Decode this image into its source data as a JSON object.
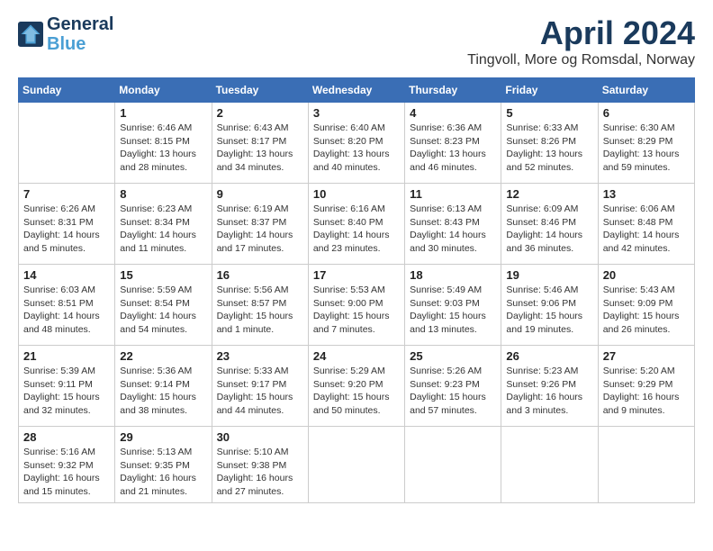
{
  "header": {
    "logo_line1": "General",
    "logo_line2": "Blue",
    "month": "April 2024",
    "location": "Tingvoll, More og Romsdal, Norway"
  },
  "calendar": {
    "headers": [
      "Sunday",
      "Monday",
      "Tuesday",
      "Wednesday",
      "Thursday",
      "Friday",
      "Saturday"
    ],
    "weeks": [
      [
        {
          "day": "",
          "info": ""
        },
        {
          "day": "1",
          "info": "Sunrise: 6:46 AM\nSunset: 8:15 PM\nDaylight: 13 hours\nand 28 minutes."
        },
        {
          "day": "2",
          "info": "Sunrise: 6:43 AM\nSunset: 8:17 PM\nDaylight: 13 hours\nand 34 minutes."
        },
        {
          "day": "3",
          "info": "Sunrise: 6:40 AM\nSunset: 8:20 PM\nDaylight: 13 hours\nand 40 minutes."
        },
        {
          "day": "4",
          "info": "Sunrise: 6:36 AM\nSunset: 8:23 PM\nDaylight: 13 hours\nand 46 minutes."
        },
        {
          "day": "5",
          "info": "Sunrise: 6:33 AM\nSunset: 8:26 PM\nDaylight: 13 hours\nand 52 minutes."
        },
        {
          "day": "6",
          "info": "Sunrise: 6:30 AM\nSunset: 8:29 PM\nDaylight: 13 hours\nand 59 minutes."
        }
      ],
      [
        {
          "day": "7",
          "info": "Sunrise: 6:26 AM\nSunset: 8:31 PM\nDaylight: 14 hours\nand 5 minutes."
        },
        {
          "day": "8",
          "info": "Sunrise: 6:23 AM\nSunset: 8:34 PM\nDaylight: 14 hours\nand 11 minutes."
        },
        {
          "day": "9",
          "info": "Sunrise: 6:19 AM\nSunset: 8:37 PM\nDaylight: 14 hours\nand 17 minutes."
        },
        {
          "day": "10",
          "info": "Sunrise: 6:16 AM\nSunset: 8:40 PM\nDaylight: 14 hours\nand 23 minutes."
        },
        {
          "day": "11",
          "info": "Sunrise: 6:13 AM\nSunset: 8:43 PM\nDaylight: 14 hours\nand 30 minutes."
        },
        {
          "day": "12",
          "info": "Sunrise: 6:09 AM\nSunset: 8:46 PM\nDaylight: 14 hours\nand 36 minutes."
        },
        {
          "day": "13",
          "info": "Sunrise: 6:06 AM\nSunset: 8:48 PM\nDaylight: 14 hours\nand 42 minutes."
        }
      ],
      [
        {
          "day": "14",
          "info": "Sunrise: 6:03 AM\nSunset: 8:51 PM\nDaylight: 14 hours\nand 48 minutes."
        },
        {
          "day": "15",
          "info": "Sunrise: 5:59 AM\nSunset: 8:54 PM\nDaylight: 14 hours\nand 54 minutes."
        },
        {
          "day": "16",
          "info": "Sunrise: 5:56 AM\nSunset: 8:57 PM\nDaylight: 15 hours\nand 1 minute."
        },
        {
          "day": "17",
          "info": "Sunrise: 5:53 AM\nSunset: 9:00 PM\nDaylight: 15 hours\nand 7 minutes."
        },
        {
          "day": "18",
          "info": "Sunrise: 5:49 AM\nSunset: 9:03 PM\nDaylight: 15 hours\nand 13 minutes."
        },
        {
          "day": "19",
          "info": "Sunrise: 5:46 AM\nSunset: 9:06 PM\nDaylight: 15 hours\nand 19 minutes."
        },
        {
          "day": "20",
          "info": "Sunrise: 5:43 AM\nSunset: 9:09 PM\nDaylight: 15 hours\nand 26 minutes."
        }
      ],
      [
        {
          "day": "21",
          "info": "Sunrise: 5:39 AM\nSunset: 9:11 PM\nDaylight: 15 hours\nand 32 minutes."
        },
        {
          "day": "22",
          "info": "Sunrise: 5:36 AM\nSunset: 9:14 PM\nDaylight: 15 hours\nand 38 minutes."
        },
        {
          "day": "23",
          "info": "Sunrise: 5:33 AM\nSunset: 9:17 PM\nDaylight: 15 hours\nand 44 minutes."
        },
        {
          "day": "24",
          "info": "Sunrise: 5:29 AM\nSunset: 9:20 PM\nDaylight: 15 hours\nand 50 minutes."
        },
        {
          "day": "25",
          "info": "Sunrise: 5:26 AM\nSunset: 9:23 PM\nDaylight: 15 hours\nand 57 minutes."
        },
        {
          "day": "26",
          "info": "Sunrise: 5:23 AM\nSunset: 9:26 PM\nDaylight: 16 hours\nand 3 minutes."
        },
        {
          "day": "27",
          "info": "Sunrise: 5:20 AM\nSunset: 9:29 PM\nDaylight: 16 hours\nand 9 minutes."
        }
      ],
      [
        {
          "day": "28",
          "info": "Sunrise: 5:16 AM\nSunset: 9:32 PM\nDaylight: 16 hours\nand 15 minutes."
        },
        {
          "day": "29",
          "info": "Sunrise: 5:13 AM\nSunset: 9:35 PM\nDaylight: 16 hours\nand 21 minutes."
        },
        {
          "day": "30",
          "info": "Sunrise: 5:10 AM\nSunset: 9:38 PM\nDaylight: 16 hours\nand 27 minutes."
        },
        {
          "day": "",
          "info": ""
        },
        {
          "day": "",
          "info": ""
        },
        {
          "day": "",
          "info": ""
        },
        {
          "day": "",
          "info": ""
        }
      ]
    ]
  }
}
